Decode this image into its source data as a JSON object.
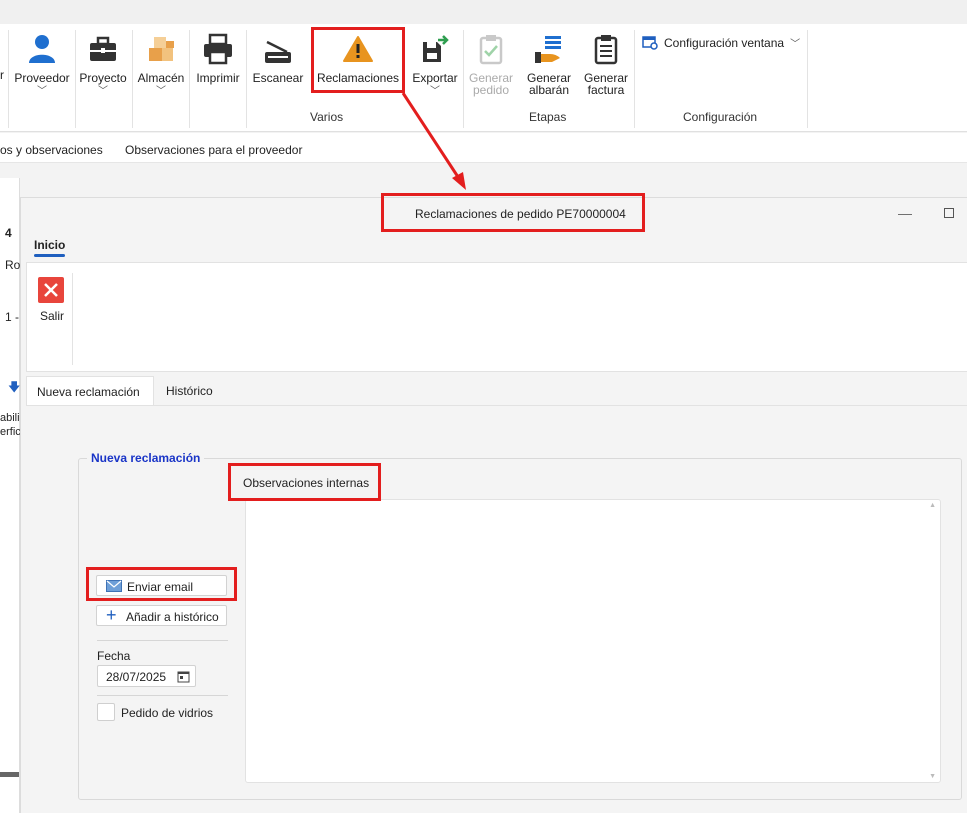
{
  "ribbon": {
    "buttons": [
      {
        "label": "Proveedor",
        "icon": "person-icon",
        "has_dropdown": true
      },
      {
        "label": "Proyecto",
        "icon": "briefcase-icon",
        "has_dropdown": true
      },
      {
        "label": "Almacén",
        "icon": "boxes-icon",
        "has_dropdown": true
      },
      {
        "label": "Imprimir",
        "icon": "printer-icon",
        "has_dropdown": false
      },
      {
        "label": "Escanear",
        "icon": "scanner-icon",
        "has_dropdown": false
      },
      {
        "label": "Reclamaciones",
        "icon": "warning-icon",
        "has_dropdown": false
      },
      {
        "label": "Exportar",
        "icon": "export-icon",
        "has_dropdown": true
      },
      {
        "label_line1": "Generar",
        "label_line2": "pedido",
        "icon": "clipboard-check-icon",
        "disabled": true
      },
      {
        "label_line1": "Generar",
        "label_line2": "albarán",
        "icon": "delivery-icon"
      },
      {
        "label_line1": "Generar",
        "label_line2": "factura",
        "icon": "invoice-icon"
      }
    ],
    "left_fragment": "r",
    "config_button": "Configuración ventana",
    "groups": {
      "varios": "Varios",
      "etapas": "Etapas",
      "configuracion": "Configuración"
    }
  },
  "bg_tabs": {
    "tab1": "os y observaciones",
    "tab2": "Observaciones para el proveedor"
  },
  "bg_fragments": {
    "num": "4",
    "ro": "Ro",
    "one": "1 -",
    "abili": "abili",
    "erfic": "erfic"
  },
  "dialog": {
    "title": "Reclamaciones de pedido PE70000004",
    "ribbon_tab": "Inicio",
    "exit_label": "Salir",
    "tabs": [
      "Nueva reclamación",
      "Histórico"
    ],
    "section_title": "Nueva reclamación",
    "observations_label": "Observaciones internas",
    "observations_value": "",
    "send_email": "Enviar email",
    "add_history": "Añadir a histórico",
    "date_label": "Fecha",
    "date_value": "28/07/2025",
    "glass_order_label": "Pedido de vidrios",
    "glass_order_checked": false
  },
  "colors": {
    "highlight": "#e31e1e",
    "accent": "#1f5fbf",
    "warning": "#e8941f",
    "exit": "#e8453c",
    "section_title": "#1a35c7"
  }
}
